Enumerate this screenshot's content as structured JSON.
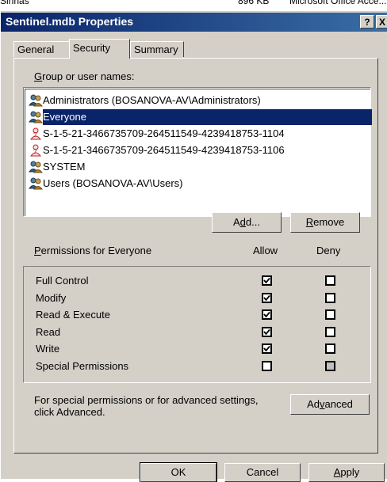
{
  "background": {
    "texts": [
      "Sinhas",
      "896 KB",
      "Microsoft Office Acce..."
    ]
  },
  "window": {
    "title": "Sentinel.mdb Properties",
    "help_label": "?",
    "close_label": "X"
  },
  "tabs": [
    {
      "label": "General",
      "active": false
    },
    {
      "label": "Security",
      "active": true
    },
    {
      "label": "Summary",
      "active": false
    }
  ],
  "group_section": {
    "label_underline": "G",
    "label_rest": "roup or user names:",
    "items": [
      {
        "label": "Administrators (BOSANOVA-AV\\Administrators)",
        "icon": "group-icon",
        "selected": false
      },
      {
        "label": "Everyone",
        "icon": "group-icon",
        "selected": true
      },
      {
        "label": "S-1-5-21-3466735709-264511549-4239418753-1104",
        "icon": "unknown-user-icon",
        "selected": false
      },
      {
        "label": "S-1-5-21-3466735709-264511549-4239418753-1106",
        "icon": "unknown-user-icon",
        "selected": false
      },
      {
        "label": "SYSTEM",
        "icon": "group-icon",
        "selected": false
      },
      {
        "label": "Users (BOSANOVA-AV\\Users)",
        "icon": "group-icon",
        "selected": false
      }
    ]
  },
  "buttons": {
    "add_pre": "A",
    "add_u": "d",
    "add_post": "d...",
    "remove_u": "R",
    "remove_post": "emove",
    "advanced_pre": "Ad",
    "advanced_u": "v",
    "advanced_post": "anced",
    "ok": "OK",
    "cancel": "Cancel",
    "apply_u": "A",
    "apply_post": "pply"
  },
  "permissions": {
    "label_underline": "P",
    "label_rest": "ermissions for Everyone",
    "allow_header": "Allow",
    "deny_header": "Deny",
    "rows": [
      {
        "name": "Full Control",
        "allow": "checked",
        "deny": "unchecked"
      },
      {
        "name": "Modify",
        "allow": "checked",
        "deny": "unchecked"
      },
      {
        "name": "Read & Execute",
        "allow": "checked",
        "deny": "unchecked"
      },
      {
        "name": "Read",
        "allow": "checked",
        "deny": "unchecked"
      },
      {
        "name": "Write",
        "allow": "checked",
        "deny": "unchecked"
      },
      {
        "name": "Special Permissions",
        "allow": "unchecked",
        "deny": "disabled"
      }
    ]
  },
  "advanced_note": {
    "line1": "For special permissions or for advanced settings,",
    "line2": "click Advanced."
  }
}
